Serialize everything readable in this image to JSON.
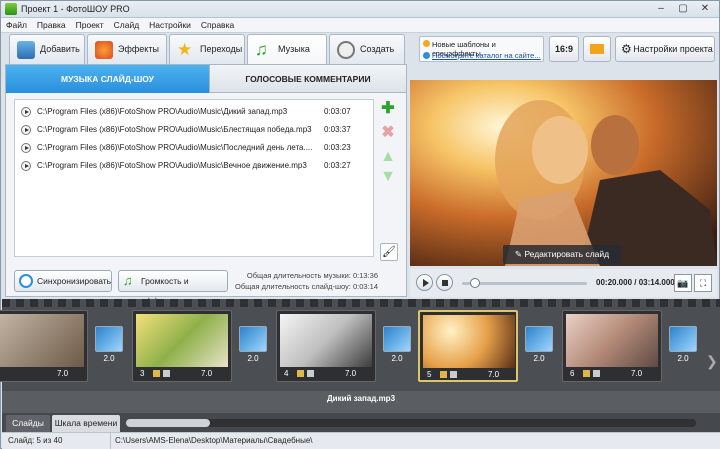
{
  "window": {
    "title": "Проект 1 - ФотоШОУ PRO",
    "min": "‒",
    "max": "▢",
    "close": "✕"
  },
  "menu": [
    "Файл",
    "Правка",
    "Проект",
    "Слайд",
    "Настройки",
    "Справка"
  ],
  "tabs": [
    {
      "label": "Добавить",
      "icon": "photo-add-icon"
    },
    {
      "label": "Эффекты",
      "icon": "effects-icon"
    },
    {
      "label": "Переходы",
      "icon": "star-icon"
    },
    {
      "label": "Музыка",
      "icon": "music-note-icon",
      "active": true
    },
    {
      "label": "Создать",
      "icon": "film-reel-icon"
    }
  ],
  "promo": {
    "line1": "Новые шаблоны и спецэффекты",
    "line2": "Посмотрите каталог на сайте..."
  },
  "top_buttons": {
    "ratio": "16:9",
    "settings": "Настройки проекта"
  },
  "subtabs": {
    "active": "МУЗЫКА СЛАЙД-ШОУ",
    "inactive": "ГОЛОСОВЫЕ КОММЕНТАРИИ"
  },
  "tracks": [
    {
      "path": "C:\\Program Files (x86)\\FotoShow PRO\\Audio\\Music\\Дикий запад.mp3",
      "duration": "0:03:07"
    },
    {
      "path": "C:\\Program Files (x86)\\FotoShow PRO\\Audio\\Music\\Блестящая победа.mp3",
      "duration": "0:03:37"
    },
    {
      "path": "C:\\Program Files (x86)\\FotoShow PRO\\Audio\\Music\\Последний день лета....",
      "duration": "0:03:23"
    },
    {
      "path": "C:\\Program Files (x86)\\FotoShow PRO\\Audio\\Music\\Вечное движение.mp3",
      "duration": "0:03:27"
    }
  ],
  "totals": {
    "music": "Общая длительность музыки: 0:13:36",
    "show": "Общая длительность слайд-шоу: 0:03:14"
  },
  "bottom_buttons": {
    "sync": "Синхронизировать",
    "volume": "Громкость и эффекты"
  },
  "preview": {
    "edit": "Редактировать слайд",
    "time": "00:20.000 / 03:14.000",
    "seek_fraction": 0.1
  },
  "slides": [
    {
      "num": "",
      "dur": "7.0"
    },
    {
      "num": "3",
      "dur": "7.0"
    },
    {
      "num": "4",
      "dur": "7.0"
    },
    {
      "num": "5",
      "dur": "7.0",
      "selected": true
    },
    {
      "num": "6",
      "dur": "7.0"
    }
  ],
  "transitions": [
    "2.0",
    "2.0",
    "2.0",
    "2.0",
    "2.0"
  ],
  "music_track": "Дикий запад.mp3",
  "view_tabs": {
    "slides": "Слайды",
    "timeline": "Шкала времени"
  },
  "status": {
    "slide": "Слайд: 5 из 40",
    "path": "C:\\Users\\AMS-Elena\\Desktop\\Материалы\\Свадебные\\"
  },
  "colors": {
    "accent": "#2a8fdc",
    "strip": "#4b4e53",
    "selected": "#e0c46a"
  }
}
